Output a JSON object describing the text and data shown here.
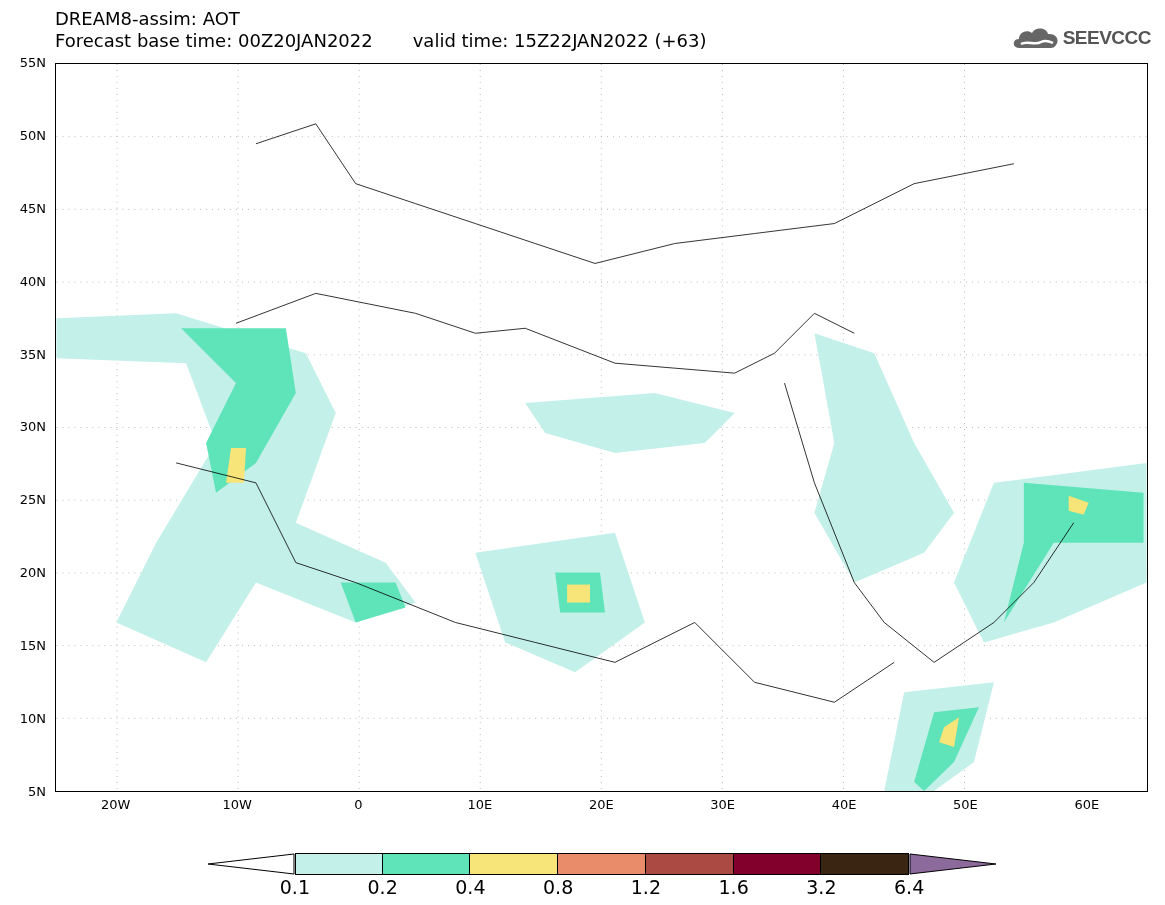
{
  "title": {
    "line_1": "DREAM8-assim: AOT",
    "base_time": "Forecast base time: 00Z20JAN2022",
    "valid_time": "valid time: 15Z22JAN2022 (+63)"
  },
  "logo": {
    "text": "SEEVCCC"
  },
  "map": {
    "y_labels": [
      "55N",
      "50N",
      "45N",
      "40N",
      "35N",
      "30N",
      "25N",
      "20N",
      "15N",
      "10N",
      "5N"
    ],
    "x_labels": [
      "20W",
      "10W",
      "0",
      "10E",
      "20E",
      "30E",
      "40E",
      "50E",
      "60E"
    ]
  },
  "legend": {
    "bins": [
      {
        "kind": "arrow-low",
        "color": "#ffffff"
      },
      {
        "kind": "box",
        "color": "#c4f0ea"
      },
      {
        "kind": "box",
        "color": "#5fe3b8"
      },
      {
        "kind": "box",
        "color": "#f7e57a"
      },
      {
        "kind": "box",
        "color": "#e98c6a"
      },
      {
        "kind": "box",
        "color": "#ab4a42"
      },
      {
        "kind": "box",
        "color": "#82002c"
      },
      {
        "kind": "box",
        "color": "#3a2412"
      },
      {
        "kind": "arrow-high",
        "color": "#8c6a9c"
      }
    ],
    "labels": [
      "0.1",
      "0.2",
      "0.4",
      "0.8",
      "1.2",
      "1.6",
      "3.2",
      "6.4"
    ]
  }
}
